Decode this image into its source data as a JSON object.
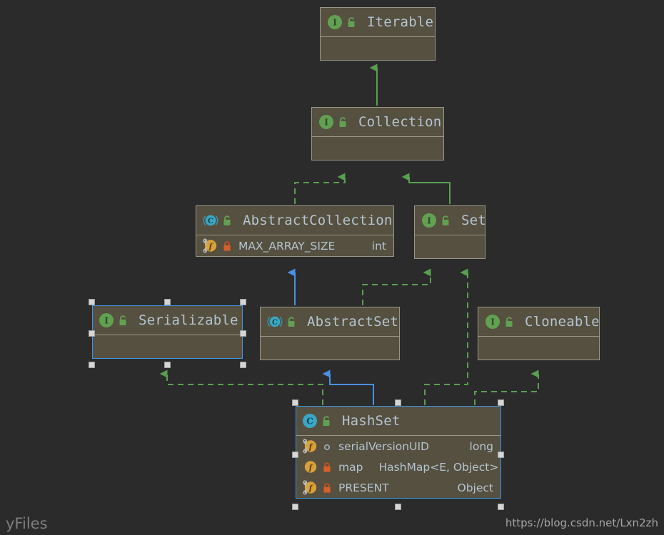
{
  "diagram": {
    "title": "Java Collections HashSet hierarchy",
    "background_color": "#2b2b2b",
    "node_fill": "#55503f",
    "node_border": "#9a968a",
    "selection_color": "#3d96e6",
    "implements_edge_color": "#5a9e52",
    "extends_edge_color": "#4a90e2",
    "text_color": "#b5c3d2"
  },
  "nodes": {
    "iterable": {
      "name": "Iterable",
      "kind_icon": "interface-icon",
      "lock_icon": "unlocked-public-icon",
      "members": []
    },
    "collection": {
      "name": "Collection",
      "kind_icon": "interface-icon",
      "lock_icon": "unlocked-public-icon",
      "members": []
    },
    "abstract_collection": {
      "name": "AbstractCollection",
      "kind_icon": "abstract-class-icon",
      "lock_icon": "unlocked-public-icon",
      "members": [
        {
          "icon": "static-field-icon",
          "visibility_icon": "private-lock-icon",
          "name": "MAX_ARRAY_SIZE",
          "type": "int"
        }
      ]
    },
    "set": {
      "name": "Set",
      "kind_icon": "interface-icon",
      "lock_icon": "unlocked-public-icon",
      "members": []
    },
    "serializable": {
      "name": "Serializable",
      "kind_icon": "interface-icon",
      "lock_icon": "unlocked-public-icon",
      "selected": true,
      "members": []
    },
    "abstract_set": {
      "name": "AbstractSet",
      "kind_icon": "abstract-class-icon",
      "lock_icon": "unlocked-public-icon",
      "members": []
    },
    "cloneable": {
      "name": "Cloneable",
      "kind_icon": "interface-icon",
      "lock_icon": "unlocked-public-icon",
      "members": []
    },
    "hashset": {
      "name": "HashSet",
      "kind_icon": "class-icon",
      "lock_icon": "unlocked-public-icon",
      "selected": true,
      "members": [
        {
          "icon": "static-field-icon",
          "visibility_icon": "package-private-icon",
          "name": "serialVersionUID",
          "type": "long"
        },
        {
          "icon": "field-icon",
          "visibility_icon": "private-lock-icon",
          "name": "map",
          "type": "HashMap<E, Object>"
        },
        {
          "icon": "static-field-icon",
          "visibility_icon": "private-lock-icon",
          "name": "PRESENT",
          "type": "Object"
        }
      ]
    }
  },
  "edges": [
    {
      "from": "collection",
      "to": "iterable",
      "style": "solid",
      "color": "#5a9e52",
      "relation": "extends-interface"
    },
    {
      "from": "abstract_collection",
      "to": "collection",
      "style": "dashed",
      "color": "#5a9e52",
      "relation": "implements"
    },
    {
      "from": "set",
      "to": "collection",
      "style": "solid",
      "color": "#5a9e52",
      "relation": "extends-interface"
    },
    {
      "from": "abstract_set",
      "to": "abstract_collection",
      "style": "solid",
      "color": "#4a90e2",
      "relation": "extends-class"
    },
    {
      "from": "abstract_set",
      "to": "set",
      "style": "dashed",
      "color": "#5a9e52",
      "relation": "implements"
    },
    {
      "from": "hashset",
      "to": "serializable",
      "style": "dashed",
      "color": "#5a9e52",
      "relation": "implements"
    },
    {
      "from": "hashset",
      "to": "abstract_set",
      "style": "solid",
      "color": "#4a90e2",
      "relation": "extends-class"
    },
    {
      "from": "hashset",
      "to": "set",
      "style": "dashed",
      "color": "#5a9e52",
      "relation": "implements"
    },
    {
      "from": "hashset",
      "to": "cloneable",
      "style": "dashed",
      "color": "#5a9e52",
      "relation": "implements"
    }
  ],
  "watermarks": {
    "left": "yFiles",
    "right": "https://blog.csdn.net/Lxn2zh"
  }
}
